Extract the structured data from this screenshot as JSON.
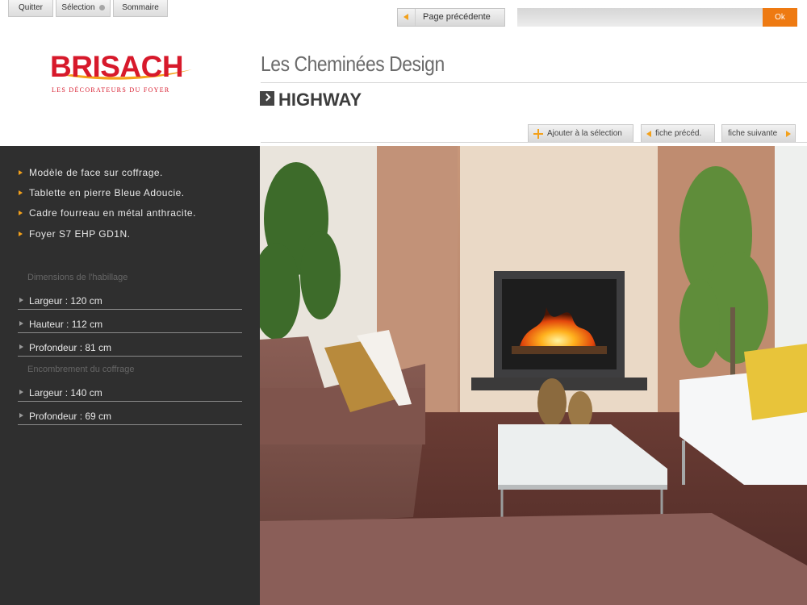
{
  "toolbar": {
    "quit_label": "Quitter",
    "selection_label": "Sélection",
    "summary_label": "Sommaire",
    "previous_page_label": "Page précédente",
    "search_value": "",
    "ok_label": "Ok"
  },
  "brand": {
    "name": "BRISACH",
    "tagline": "LES DÉCORATEURS DU FOYER"
  },
  "section": {
    "title": "Les Cheminées Design",
    "product_name": "HIGHWAY"
  },
  "product_nav": {
    "add_to_selection": "Ajouter à la sélection",
    "previous_sheet": "fiche précéd.",
    "next_sheet": "fiche suivante"
  },
  "features": [
    "Modèle de face sur coffrage.",
    "Tablette en pierre Bleue Adoucie.",
    "Cadre fourreau en métal anthracite.",
    "Foyer S7 EHP GD1N."
  ],
  "dimensions": {
    "habillage_heading": "Dimensions de l'habillage",
    "habillage": [
      "Largeur : 120 cm",
      "Hauteur : 112 cm",
      "Profondeur : 81 cm"
    ],
    "coffrage_heading": "Encombrement du coffrage",
    "coffrage": [
      "Largeur : 140 cm",
      "Profondeur : 69 cm"
    ]
  },
  "colors": {
    "accent_orange": "#ee7a12",
    "brand_red": "#d7192b",
    "panel_dark": "#2f2f2f"
  }
}
